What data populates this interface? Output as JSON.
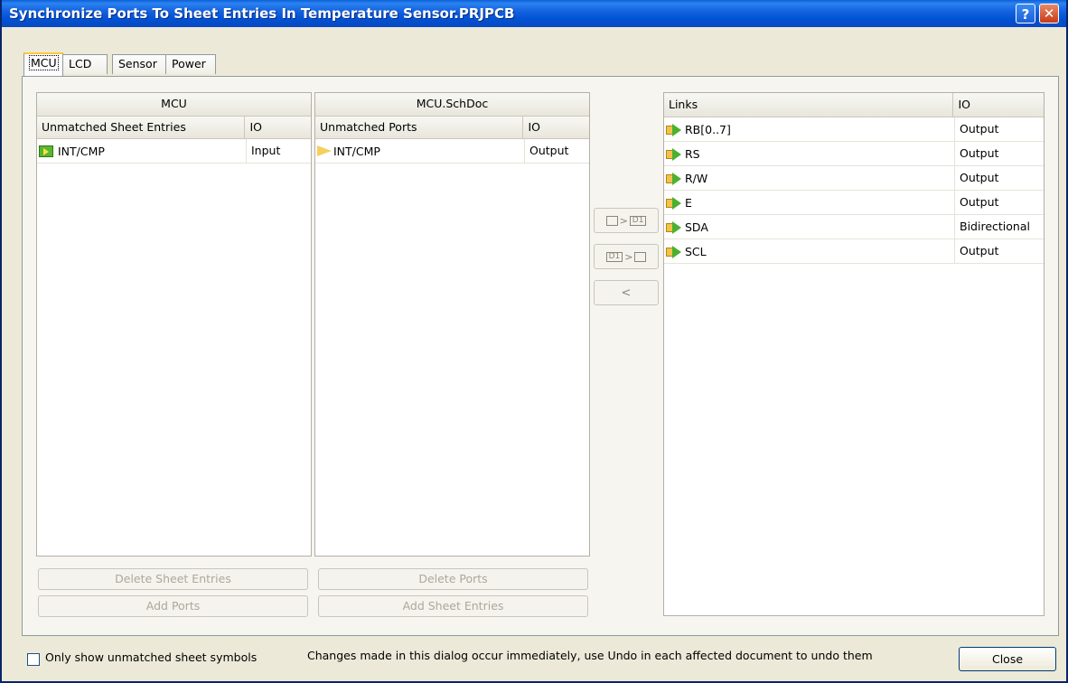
{
  "window": {
    "title": "Synchronize Ports To Sheet Entries In Temperature Sensor.PRJPCB",
    "help_glyph": "?",
    "close_glyph": "✕"
  },
  "tabs": [
    {
      "label": "MCU",
      "active": true
    },
    {
      "label": "LCD",
      "active": false
    },
    {
      "label": "Sensor",
      "active": false
    },
    {
      "label": "Power",
      "active": false
    }
  ],
  "sheet_panel": {
    "title": "MCU",
    "columns": [
      "Unmatched Sheet Entries",
      "IO"
    ],
    "rows": [
      {
        "name": "INT/CMP",
        "io": "Input"
      }
    ],
    "delete_button": "Delete Sheet Entries",
    "add_button": "Add Ports"
  },
  "ports_panel": {
    "title": "MCU.SchDoc",
    "columns": [
      "Unmatched Ports",
      "IO"
    ],
    "rows": [
      {
        "name": "INT/CMP",
        "io": "Output"
      }
    ],
    "delete_button": "Delete Ports",
    "add_button": "Add Sheet Entries"
  },
  "middle_buttons": {
    "link_label": ">",
    "port_label": "D1",
    "unlink_label": "<"
  },
  "links_panel": {
    "columns": [
      "Links",
      "IO"
    ],
    "rows": [
      {
        "name": "RB[0..7]",
        "io": "Output"
      },
      {
        "name": "RS",
        "io": "Output"
      },
      {
        "name": "R/W",
        "io": "Output"
      },
      {
        "name": "E",
        "io": "Output"
      },
      {
        "name": "SDA",
        "io": "Bidirectional"
      },
      {
        "name": "SCL",
        "io": "Output"
      }
    ]
  },
  "footer": {
    "checkbox_label": "Only show unmatched sheet symbols",
    "checkbox_checked": false,
    "status_text": "Changes made in this dialog occur immediately, use Undo in each affected document to undo them",
    "close_button": "Close"
  }
}
